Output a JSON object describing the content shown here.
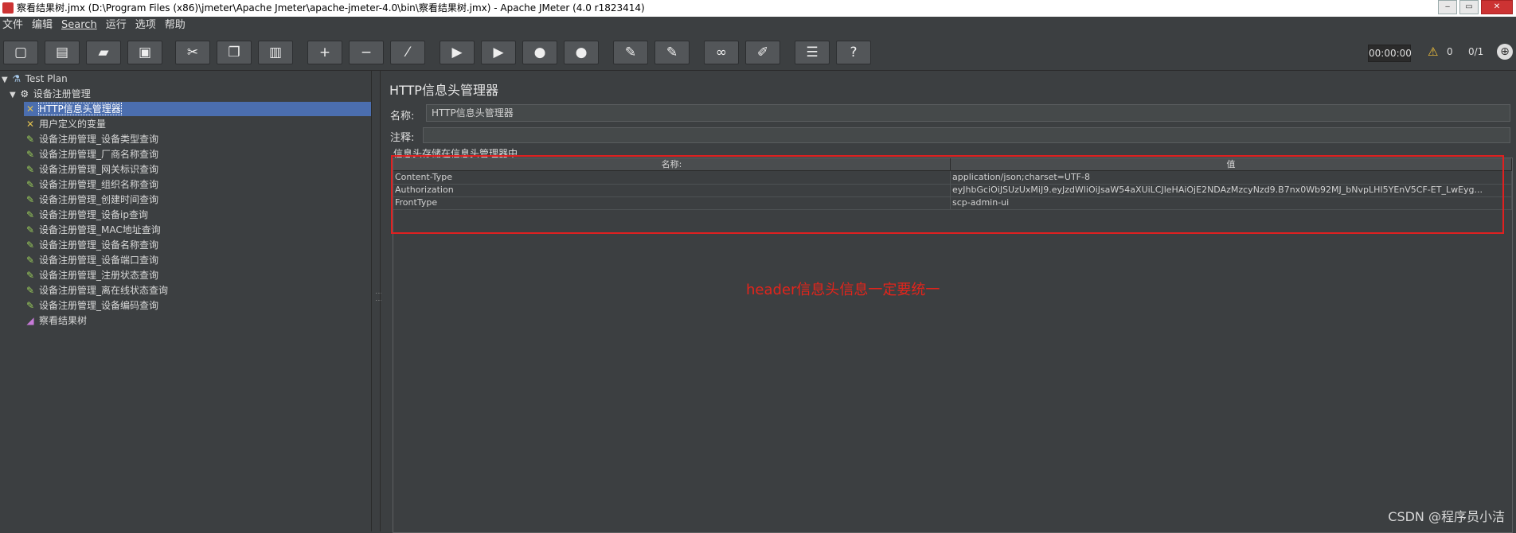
{
  "window": {
    "title": "察看结果树.jmx (D:\\Program Files (x86)\\jmeter\\Apache Jmeter\\apache-jmeter-4.0\\bin\\察看结果树.jmx) - Apache JMeter (4.0 r1823414)",
    "minimize": "‒",
    "maximize": "▭",
    "close": "✕"
  },
  "menu": [
    "文件",
    "编辑",
    "Search",
    "运行",
    "选项",
    "帮助"
  ],
  "toolbar": {
    "buttons": [
      {
        "name": "new-button",
        "icon": "new-file-icon",
        "glyph": "▢"
      },
      {
        "name": "templates-button",
        "icon": "templates-icon",
        "glyph": "▤"
      },
      {
        "name": "open-button",
        "icon": "open-folder-icon",
        "glyph": "▰"
      },
      {
        "name": "save-button",
        "icon": "save-icon",
        "glyph": "▣"
      },
      {
        "name": "cut-button",
        "icon": "scissors-icon",
        "glyph": "✂"
      },
      {
        "name": "copy-button",
        "icon": "copy-icon",
        "glyph": "❐"
      },
      {
        "name": "paste-button",
        "icon": "paste-icon",
        "glyph": "▥"
      },
      {
        "name": "expand-button",
        "icon": "plus-icon",
        "glyph": "+"
      },
      {
        "name": "collapse-button",
        "icon": "minus-icon",
        "glyph": "−"
      },
      {
        "name": "toggle-button",
        "icon": "wand-icon",
        "glyph": "⁄"
      },
      {
        "name": "start-button",
        "icon": "play-icon",
        "glyph": "▶"
      },
      {
        "name": "start-no-pause-button",
        "icon": "play-timer-icon",
        "glyph": "▶"
      },
      {
        "name": "stop-button",
        "icon": "stop-icon",
        "glyph": "●"
      },
      {
        "name": "shutdown-button",
        "icon": "shutdown-icon",
        "glyph": "●"
      },
      {
        "name": "clear-button",
        "icon": "broom-icon",
        "glyph": "✎"
      },
      {
        "name": "clear-all-button",
        "icon": "broom-all-icon",
        "glyph": "✎"
      },
      {
        "name": "search-button",
        "icon": "binoculars-icon",
        "glyph": "∞"
      },
      {
        "name": "reset-search-button",
        "icon": "brush-icon",
        "glyph": "✐"
      },
      {
        "name": "function-helper-button",
        "icon": "list-icon",
        "glyph": "☰"
      },
      {
        "name": "help-button",
        "icon": "help-icon",
        "glyph": "?"
      }
    ],
    "timer": "00:00:00",
    "warning_count": "0",
    "threads": "0/1"
  },
  "tree": [
    {
      "label": "Test Plan",
      "icon": "flask-icon",
      "glyph": "⚗",
      "arrow": "▼",
      "level": 0
    },
    {
      "label": "设备注册管理",
      "icon": "gear-icon",
      "glyph": "⚙",
      "arrow": "▼",
      "level": 1
    },
    {
      "label": "HTTP信息头管理器",
      "icon": "tools-icon",
      "glyph": "✕",
      "arrow": "",
      "level": 2,
      "selected": true
    },
    {
      "label": "用户定义的变量",
      "icon": "tools-icon",
      "glyph": "✕",
      "arrow": "",
      "level": 2
    },
    {
      "label": "设备注册管理_设备类型查询",
      "icon": "pencil-icon",
      "glyph": "✎",
      "arrow": "",
      "level": 2
    },
    {
      "label": "设备注册管理_厂商名称查询",
      "icon": "pencil-icon",
      "glyph": "✎",
      "arrow": "",
      "level": 2
    },
    {
      "label": "设备注册管理_网关标识查询",
      "icon": "pencil-icon",
      "glyph": "✎",
      "arrow": "",
      "level": 2
    },
    {
      "label": "设备注册管理_组织名称查询",
      "icon": "pencil-icon",
      "glyph": "✎",
      "arrow": "",
      "level": 2
    },
    {
      "label": "设备注册管理_创建时间查询",
      "icon": "pencil-icon",
      "glyph": "✎",
      "arrow": "",
      "level": 2
    },
    {
      "label": "设备注册管理_设备ip查询",
      "icon": "pencil-icon",
      "glyph": "✎",
      "arrow": "",
      "level": 2
    },
    {
      "label": "设备注册管理_MAC地址查询",
      "icon": "pencil-icon",
      "glyph": "✎",
      "arrow": "",
      "level": 2
    },
    {
      "label": "设备注册管理_设备名称查询",
      "icon": "pencil-icon",
      "glyph": "✎",
      "arrow": "",
      "level": 2
    },
    {
      "label": "设备注册管理_设备端口查询",
      "icon": "pencil-icon",
      "glyph": "✎",
      "arrow": "",
      "level": 2
    },
    {
      "label": "设备注册管理_注册状态查询",
      "icon": "pencil-icon",
      "glyph": "✎",
      "arrow": "",
      "level": 2
    },
    {
      "label": "设备注册管理_离在线状态查询",
      "icon": "pencil-icon",
      "glyph": "✎",
      "arrow": "",
      "level": 2
    },
    {
      "label": "设备注册管理_设备编码查询",
      "icon": "pencil-icon",
      "glyph": "✎",
      "arrow": "",
      "level": 2
    },
    {
      "label": "察看结果树",
      "icon": "chart-icon",
      "glyph": "◢",
      "arrow": "",
      "level": 2
    }
  ],
  "panel": {
    "title": "HTTP信息头管理器",
    "name_label": "名称:",
    "name_value": "HTTP信息头管理器",
    "comment_label": "注释:",
    "group_caption": "信息头存储在信息头管理器中",
    "columns": [
      "名称:",
      "值"
    ],
    "rows": [
      {
        "name": "Content-Type",
        "value": "application/json;charset=UTF-8"
      },
      {
        "name": "Authorization",
        "value": "eyJhbGciOiJSUzUxMiJ9.eyJzdWliOiJsaW54aXUiLCJleHAiOjE2NDAzMzcyNzd9.B7nx0Wb92MJ_bNvpLHI5YEnV5CF-ET_LwEyg..."
      },
      {
        "name": "FrontType",
        "value": "scp-admin-ui"
      }
    ]
  },
  "annotation": "header信息头信息一定要统一",
  "watermark": "CSDN @程序员小洁",
  "colors": {
    "annotation": "#e3241b",
    "selection": "#4b6eaf",
    "background": "#3c3f41"
  }
}
